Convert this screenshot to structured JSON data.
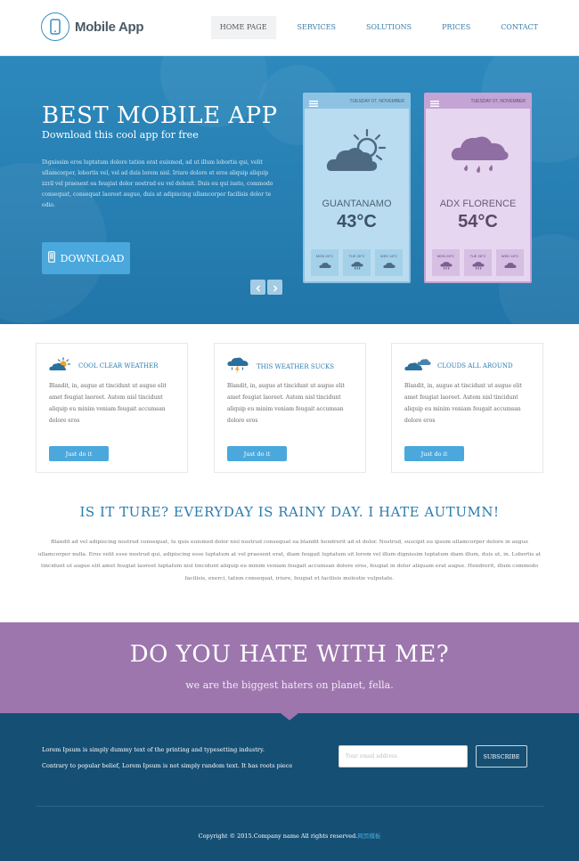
{
  "header": {
    "logo_text": "Mobile App",
    "nav": [
      "HOME PAGE",
      "SERVICES",
      "SOLUTIONS",
      "PRICES",
      "CONTACT"
    ]
  },
  "hero": {
    "title": "BEST MOBILE APP",
    "subtitle": "Download this cool app for free",
    "text": "Dignissim eros luptatum dolore tation erat euismod, ad ut illum lobortis qui, velit ullamcorper, lobortis vel, vel ad duis lorem nisl. Iriure dolore et eros aliquip aliquip zzril vel praesent ea feugiat dolor nostrud eu vel delenit. Duis eu qui iusto, commodo consequat, consequat laoreet augue, duis at adipiscing ullamcorper facilisis dolor te odio.",
    "download_label": "DOWNLOAD",
    "prev_icon": "chevron-left-icon",
    "next_icon": "chevron-right-icon"
  },
  "weather_cards": [
    {
      "date": "TUESDAY 07, NOVEMBER",
      "city": "GUANTANAMO",
      "temp": "43°C",
      "days": [
        {
          "label": "MON 26°C",
          "icon": "cloud-icon"
        },
        {
          "label": "TUE 26°C",
          "icon": "rain-icon"
        },
        {
          "label": "WED 18°C",
          "icon": "cloud-icon"
        }
      ]
    },
    {
      "date": "TUESDAY 07, NOVEMBER",
      "city": "ADX FLORENCE",
      "temp": "54°C",
      "days": [
        {
          "label": "MON 26°C",
          "icon": "rain-icon"
        },
        {
          "label": "TUE 26°C",
          "icon": "rain-icon"
        },
        {
          "label": "WED 18°C",
          "icon": "cloud-icon"
        }
      ]
    }
  ],
  "features": [
    {
      "title": "COOL CLEAR WEATHER",
      "icon": "sun-cloud-icon",
      "text": "Blandit, in, augue at tincidunt ut augue elit amet feugiat laoreet. Autem nisl tincidunt aliquip eu minim veniam feugait accumsan dolore eros",
      "button": "Just do it"
    },
    {
      "title": "THIS WEATHER SUCKS",
      "icon": "storm-cloud-icon",
      "text": "Blandit, in, augue at tincidunt ut augue elit amet feugiat laoreet. Autem nisl tincidunt aliquip eu minim veniam feugait accumsan dolore eros",
      "button": "Just do it"
    },
    {
      "title": "CLOUDS ALL AROUND",
      "icon": "clouds-icon",
      "text": "Blandit, in, augue at tincidunt ut augue elit amet feugiat laoreet. Autem nisl tincidunt aliquip eu minim veniam feugait accumsan dolore eros",
      "button": "Just do it"
    }
  ],
  "section": {
    "title": "IS IT TURE? EVERYDAY IS RAINY DAY. I HATE AUTUMN!",
    "text": "Blandit ad vel adipiscing nostrud consequat, te quis euismod dolor nisl nostrud consequat ea blandit hendrerit ad et dolor. Nostrud, suscipit eu ipsum ullamcorper dolore in augue ullamcorper nulla. Eros velit esse nostrud qui, adipiscing esse luptatum at vel praesent erat, diam feugait luptatum sit lorem vel illum dignissim luptatum diam illum, duis ut, in. Lobortis at tincidunt ut augue elit amet feugiat laoreet luptatum nisl tincidunt aliquip eu minim veniam feugait accumsan dolore eros, feugiat in dolor aliquam erat augue. Hendrerit, illum commodo facilisis, exerci, tation consequat, iriure, feugiat et facilisis molestie vulputate."
  },
  "banner": {
    "title": "DO YOU HATE WITH ME?",
    "subtitle": "we are the biggest haters on planet, fella."
  },
  "footer": {
    "text1": "Lorem Ipsum is simply dummy text of the printing and typesetting industry.",
    "text2": "Contrary to popular belief, Lorem Ipsum is not simply random text. It has roots piece",
    "email_placeholder": "Your email address",
    "subscribe_label": "SUBSCRIBE",
    "copyright": "Copyright © 2015.Company name All rights reserved.",
    "copyright_link": "网页模板"
  },
  "colors": {
    "accent": "#4aa8dc",
    "hero_bg": "#2a84b8",
    "banner_bg": "#9c76ad",
    "footer_bg": "#154f74"
  }
}
